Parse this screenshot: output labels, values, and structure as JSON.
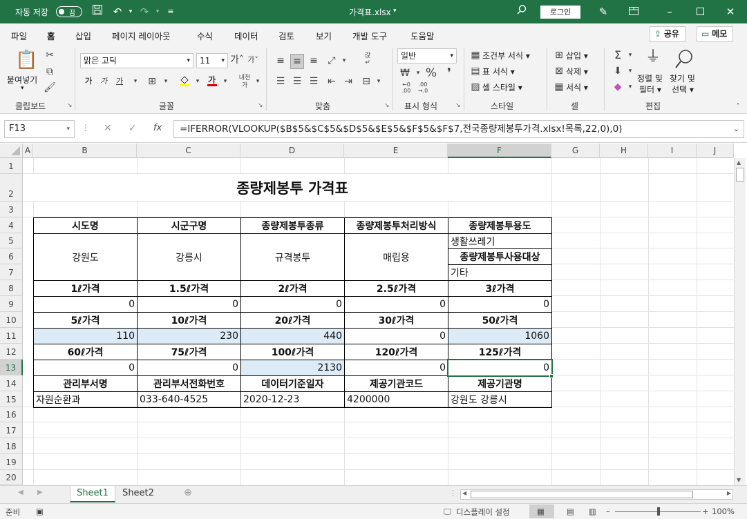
{
  "titlebar": {
    "autosave_label": "자동 저장",
    "toggle_label": "끔",
    "filename": "가격표.xlsx",
    "login_label": "로그인"
  },
  "tabs": [
    {
      "label": "파일"
    },
    {
      "label": "홈"
    },
    {
      "label": "삽입"
    },
    {
      "label": "페이지 레이아웃"
    },
    {
      "label": "수식"
    },
    {
      "label": "데이터"
    },
    {
      "label": "검토"
    },
    {
      "label": "보기"
    },
    {
      "label": "개발 도구"
    },
    {
      "label": "도움말"
    }
  ],
  "share": {
    "share_label": "공유",
    "memo_label": "메모"
  },
  "ribbon": {
    "clipboard": {
      "paste_label": "붙여넣기",
      "group": "클립보드"
    },
    "font": {
      "font_name": "맑은 고딕",
      "font_size": "11",
      "group": "글꼴"
    },
    "alignment": {
      "group": "맞춤"
    },
    "number": {
      "format": "일반",
      "group": "표시 형식"
    },
    "styles": {
      "conditional": "조건부 서식",
      "table": "표 서식",
      "cell": "셀 스타일",
      "group": "스타일"
    },
    "cells": {
      "insert": "삽입",
      "delete": "삭제",
      "format": "서식",
      "group": "셀"
    },
    "editing": {
      "sort_line1": "정렬 및",
      "sort_line2": "필터",
      "find_line1": "찾기 및",
      "find_line2": "선택",
      "group": "편집"
    }
  },
  "formula_bar": {
    "name_box": "F13",
    "formula": "=IFERROR(VLOOKUP($B$5&$C$5&$D$5&$E$5&$F$5&$F$7,전국종량제봉투가격.xlsx!목록,22,0),0)"
  },
  "columns": [
    "A",
    "B",
    "C",
    "D",
    "E",
    "F",
    "G",
    "H",
    "I",
    "J"
  ],
  "rows": [
    "1",
    "2",
    "3",
    "4",
    "5",
    "6",
    "7",
    "8",
    "9",
    "10",
    "11",
    "12",
    "13",
    "14",
    "15",
    "16",
    "17",
    "18",
    "19",
    "20"
  ],
  "sheet": {
    "title": "종량제봉투 가격표",
    "h4": [
      "시도명",
      "시군구명",
      "종량제봉투종류",
      "종량제봉투처리방식",
      "종량제봉투용도"
    ],
    "f5": "생활쓰레기",
    "f6": "종량제봉투사용대상",
    "f7": "기타",
    "merged5": [
      "강원도",
      "강릉시",
      "규격봉투",
      "매립용"
    ],
    "h8": [
      "1ℓ가격",
      "1.5ℓ가격",
      "2ℓ가격",
      "2.5ℓ가격",
      "3ℓ가격"
    ],
    "v9": [
      "0",
      "0",
      "0",
      "0",
      "0"
    ],
    "h10": [
      "5ℓ가격",
      "10ℓ가격",
      "20ℓ가격",
      "30ℓ가격",
      "50ℓ가격"
    ],
    "v11": [
      "110",
      "230",
      "440",
      "0",
      "1060"
    ],
    "h12": [
      "60ℓ가격",
      "75ℓ가격",
      "100ℓ가격",
      "120ℓ가격",
      "125ℓ가격"
    ],
    "v13": [
      "0",
      "0",
      "2130",
      "0",
      "0"
    ],
    "h14": [
      "관리부서명",
      "관리부서전화번호",
      "데이터기준일자",
      "제공기관코드",
      "제공기관명"
    ],
    "v15": [
      "자원순환과",
      "033-640-4525",
      "2020-12-23",
      "4200000",
      "강원도 강릉시"
    ]
  },
  "sheet_tabs": [
    "Sheet1",
    "Sheet2"
  ],
  "status": {
    "ready": "준비",
    "display_settings": "디스플레이 설정",
    "zoom": "100%"
  }
}
